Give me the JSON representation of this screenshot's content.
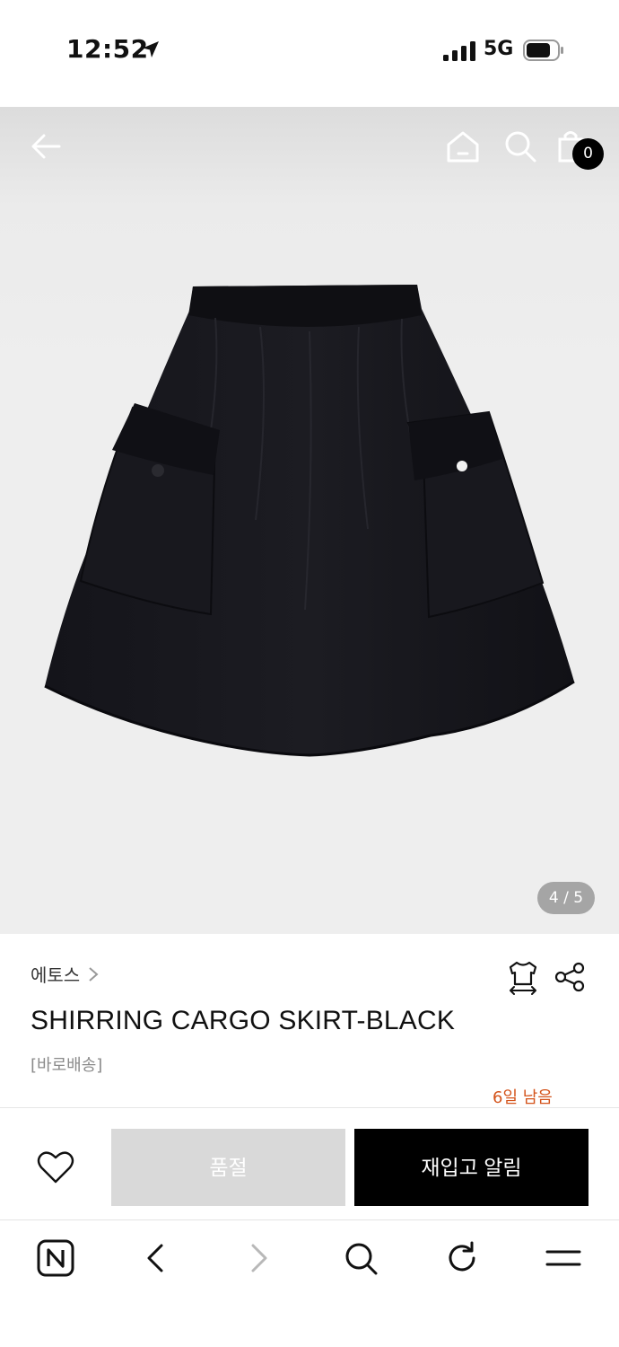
{
  "status_bar": {
    "time": "12:52",
    "network": "5G",
    "icons": [
      "location-arrow-icon",
      "signal-icon",
      "battery-icon"
    ]
  },
  "header": {
    "cart_count": "0",
    "icons": [
      "back-arrow-icon",
      "home-icon",
      "search-icon",
      "shopping-bag-icon"
    ]
  },
  "gallery": {
    "page_indicator": "4 / 5",
    "current_page": 4,
    "total_pages": 5
  },
  "product": {
    "brand": "에토스",
    "title": "SHIRRING CARGO SKIRT-BLACK",
    "delivery_tag": "[바로배송]",
    "days_left": "6일 남음"
  },
  "actions": {
    "sold_out_label": "품절",
    "restock_label": "재입고 알림"
  },
  "browser_toolbar": {
    "icons": [
      "naver-home-icon",
      "back-icon",
      "forward-icon",
      "search-icon",
      "reload-icon",
      "menu-icon"
    ]
  },
  "colors": {
    "accent_orange": "#d4541c",
    "primary_black": "#000000",
    "disabled_gray": "#d9d9d9"
  }
}
